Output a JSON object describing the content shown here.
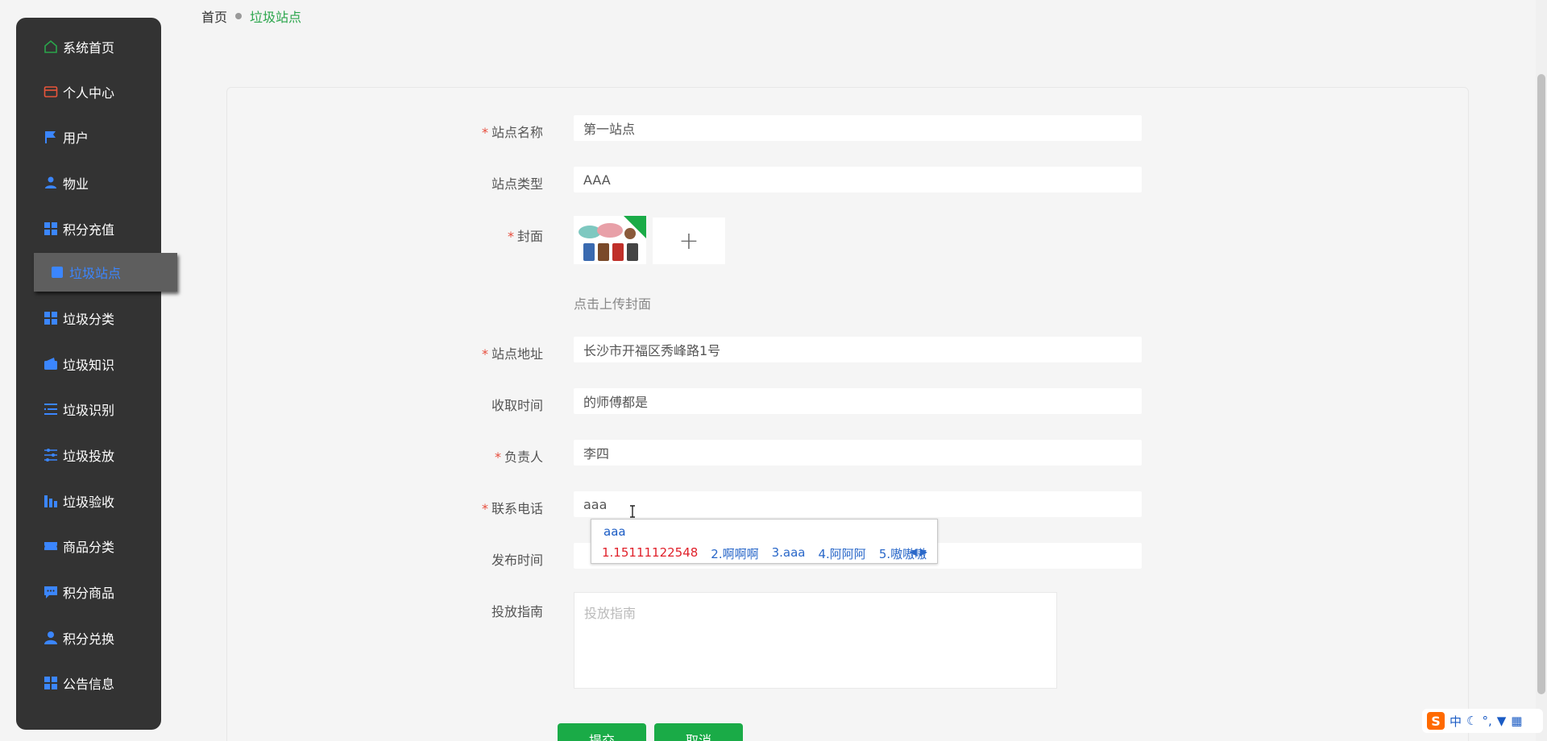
{
  "sidebar": {
    "items": [
      {
        "label": "系统首页",
        "icon": "home-icon",
        "color": "#2aa54b"
      },
      {
        "label": "个人中心",
        "icon": "card-icon",
        "color": "#e8553b"
      },
      {
        "label": "用户",
        "icon": "flag-icon",
        "color": "#3b86ff"
      },
      {
        "label": "物业",
        "icon": "person-icon",
        "color": "#3b86ff"
      },
      {
        "label": "积分充值",
        "icon": "grid-icon",
        "color": "#3b86ff"
      },
      {
        "label": "垃圾站点",
        "icon": "square-icon",
        "color": "#3b86ff",
        "active": true
      },
      {
        "label": "垃圾分类",
        "icon": "grid-icon",
        "color": "#3b86ff"
      },
      {
        "label": "垃圾知识",
        "icon": "wallet-icon",
        "color": "#3b86ff"
      },
      {
        "label": "垃圾识别",
        "icon": "list-icon",
        "color": "#3b86ff"
      },
      {
        "label": "垃圾投放",
        "icon": "sliders-icon",
        "color": "#3b86ff"
      },
      {
        "label": "垃圾验收",
        "icon": "chart-icon",
        "color": "#3b86ff"
      },
      {
        "label": "商品分类",
        "icon": "ticket-icon",
        "color": "#3b86ff"
      },
      {
        "label": "积分商品",
        "icon": "chat-icon",
        "color": "#3b86ff"
      },
      {
        "label": "积分兑换",
        "icon": "user-icon",
        "color": "#3b86ff"
      },
      {
        "label": "公告信息",
        "icon": "grid-icon",
        "color": "#3b86ff"
      }
    ]
  },
  "breadcrumb": {
    "home": "首页",
    "current": "垃圾站点"
  },
  "form": {
    "name": {
      "label": "站点名称",
      "value": "第一站点",
      "required": true
    },
    "type": {
      "label": "站点类型",
      "value": "AAA",
      "required": false
    },
    "cover": {
      "label": "封面",
      "required": true,
      "upload_hint": "点击上传封面",
      "plus": "+"
    },
    "address": {
      "label": "站点地址",
      "value": "长沙市开福区秀峰路1号",
      "required": true
    },
    "collect_time": {
      "label": "收取时间",
      "value": "的师傅都是",
      "required": false
    },
    "manager": {
      "label": "负责人",
      "value": "李四",
      "required": true
    },
    "phone": {
      "label": "联系电话",
      "value": "aaa",
      "required": true
    },
    "publish_time": {
      "label": "发布时间",
      "value": "",
      "required": false
    },
    "guide": {
      "label": "投放指南",
      "placeholder": "投放指南",
      "required": false
    }
  },
  "buttons": {
    "submit": "提交",
    "cancel": "取消"
  },
  "ime_popup": {
    "input": "aaa",
    "candidates": [
      "1.15111122548",
      "2.啊啊啊",
      "3.aaa",
      "4.阿阿阿",
      "5.嗷嗷嗷"
    ]
  },
  "ime_bar": {
    "logo": "S",
    "mode": "中"
  },
  "required_mark": "*"
}
